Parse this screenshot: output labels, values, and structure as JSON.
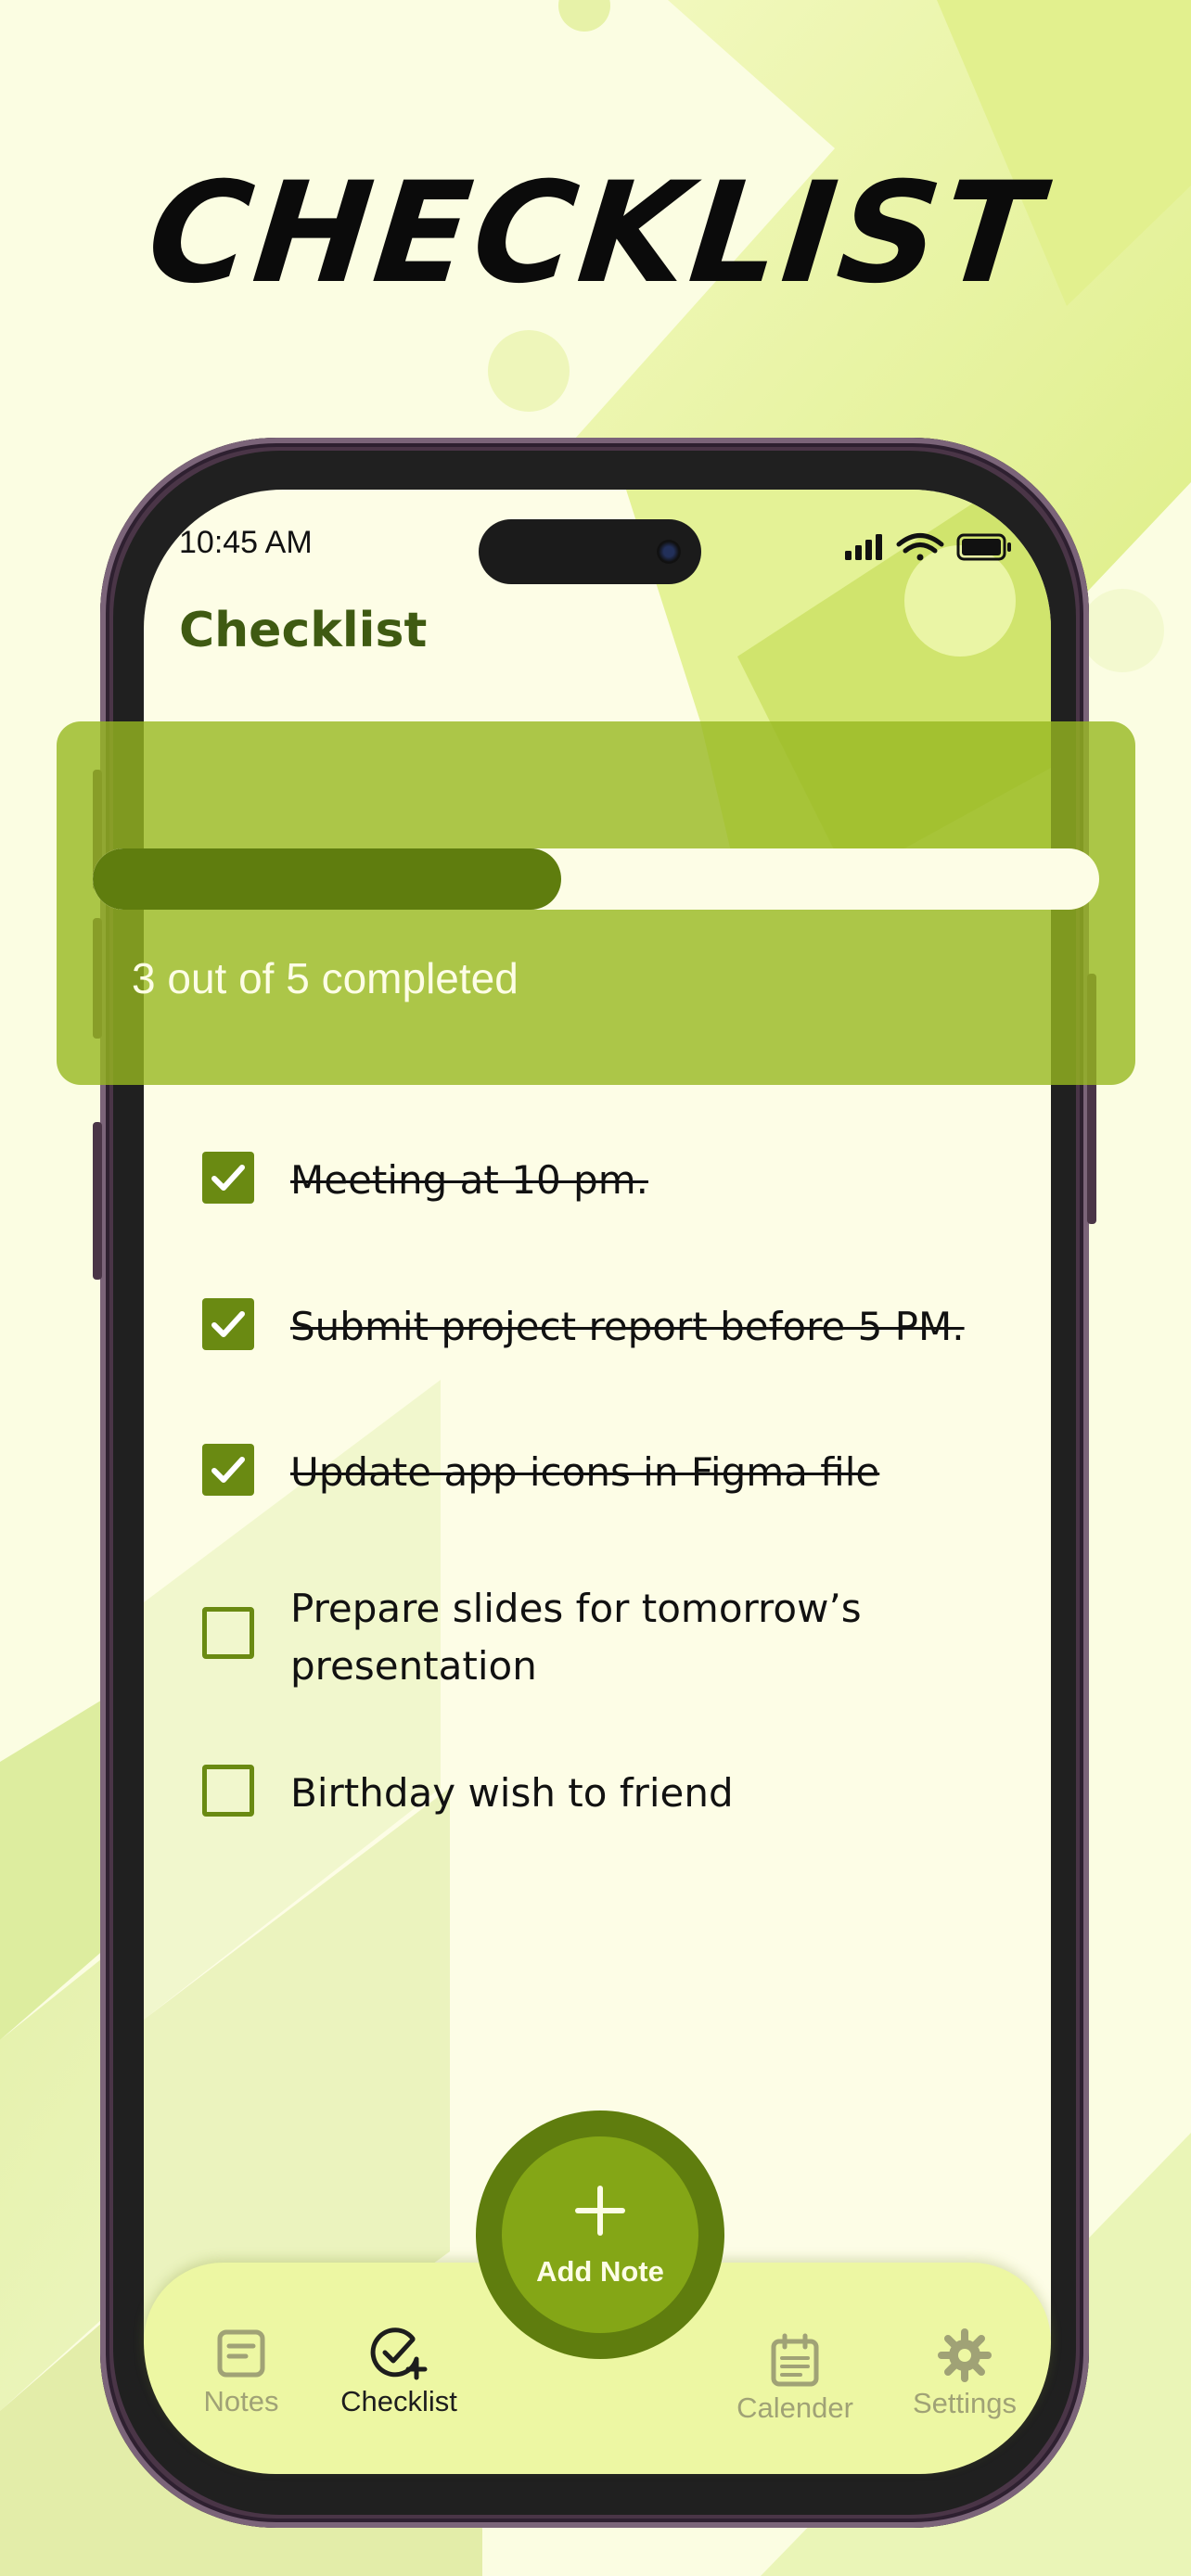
{
  "colors": {
    "background": "#fbfde2",
    "accent_dark": "#5f7d0e",
    "accent": "#84a616",
    "card": "#97b821",
    "title_text": "#3f5a12",
    "nav_background": "#edf7a3"
  },
  "hero": {
    "title": "CHECKLIST"
  },
  "status_bar": {
    "time": "10:45 AM",
    "icons": [
      "cellular-signal-icon",
      "wifi-icon",
      "battery-icon"
    ]
  },
  "screen": {
    "title": "Checklist"
  },
  "progress": {
    "completed": 3,
    "total": 5,
    "fraction": 0.465,
    "text": "3 out of 5 completed"
  },
  "tasks": [
    {
      "label": "Meeting at 10 pm.",
      "checked": true
    },
    {
      "label": "Submit project report before 5 PM.",
      "checked": true
    },
    {
      "label": "Update app icons in Figma file",
      "checked": true
    },
    {
      "label": "Prepare slides for tomorrow’s presentation",
      "checked": false
    },
    {
      "label": "Birthday wish to friend",
      "checked": false
    }
  ],
  "fab": {
    "label": "Add Note",
    "icon": "plus-icon"
  },
  "nav": [
    {
      "label": "Notes",
      "icon": "notes-icon",
      "active": false
    },
    {
      "label": "Checklist",
      "icon": "checklist-icon",
      "active": true
    },
    {
      "label": "Calender",
      "icon": "calendar-icon",
      "active": false
    },
    {
      "label": "Settings",
      "icon": "gear-icon",
      "active": false
    }
  ]
}
